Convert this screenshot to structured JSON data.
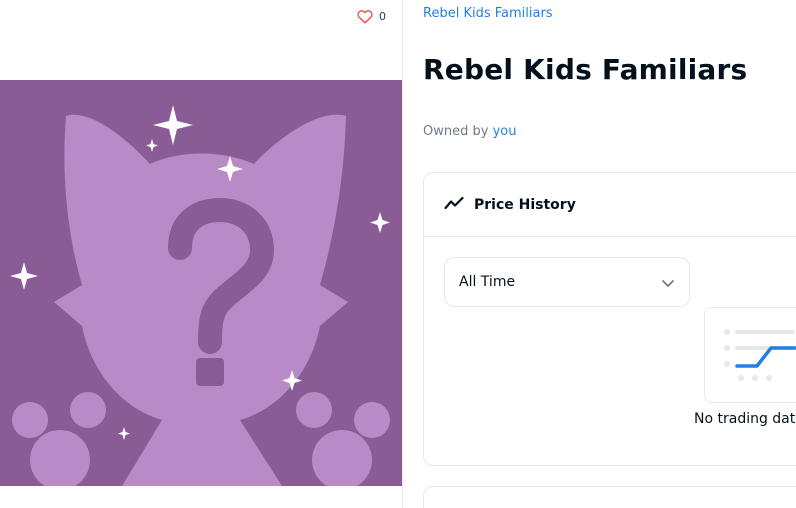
{
  "favorite": {
    "count": "0"
  },
  "collection": {
    "link_text": "Rebel Kids Familiars"
  },
  "item": {
    "title": "Rebel Kids Familiars"
  },
  "owner": {
    "prefix": "Owned by ",
    "name": "you"
  },
  "price_history": {
    "title": "Price History",
    "period": "All Time",
    "empty_message": "No trading data yet"
  },
  "colors": {
    "art_background": "#8a5c96",
    "silhouette": "#b98bc6",
    "accent": "#2081e2"
  },
  "icons": {
    "favorite": "heart-icon",
    "price_history": "trend-icon",
    "dropdown": "chevron-down-icon",
    "placeholder": "question-mark-icon"
  }
}
